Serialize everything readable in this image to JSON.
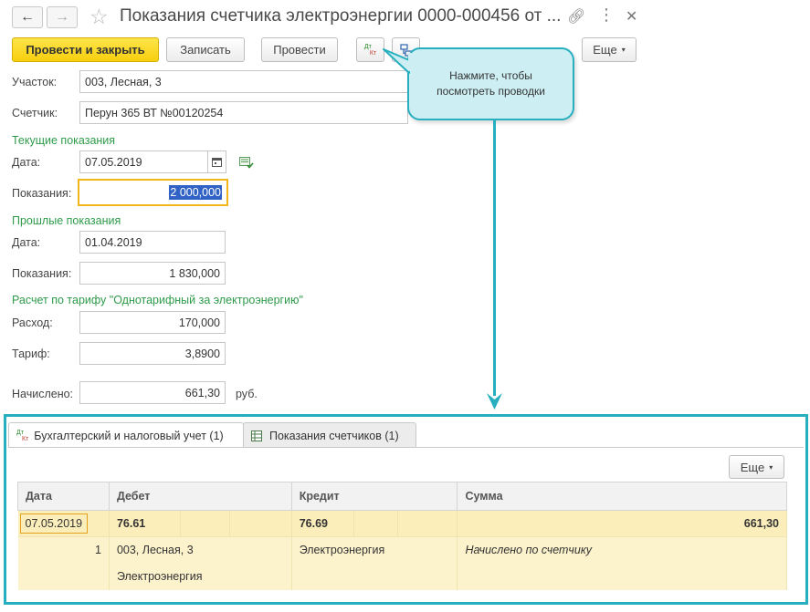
{
  "window": {
    "title": "Показания счетчика электроэнергии 0000-000456 от ..."
  },
  "toolbar": {
    "post_close": "Провести и закрыть",
    "save": "Записать",
    "post": "Провести",
    "dt": "Дт",
    "kt": "Кт",
    "more": "Еще"
  },
  "callout": {
    "text": "Нажмите, чтобы посмотреть проводки"
  },
  "form": {
    "site_label": "Участок:",
    "site_value": "003, Лесная, 3",
    "meter_label": "Счетчик:",
    "meter_value": "Перун 365 ВТ №00120254",
    "current_section": "Текущие показания",
    "current_date_label": "Дата:",
    "current_date": "07.05.2019",
    "current_reading_label": "Показания:",
    "current_reading": "2 000,000",
    "prev_section": "Прошлые показания",
    "prev_date_label": "Дата:",
    "prev_date": "01.04.2019",
    "prev_reading_label": "Показания:",
    "prev_reading": "1 830,000",
    "tariff_section": "Расчет по тарифу \"Однотарифный за электроэнергию\"",
    "usage_label": "Расход:",
    "usage_value": "170,000",
    "tariff_label": "Тариф:",
    "tariff_value": "3,8900",
    "charged_label": "Начислено:",
    "charged_value": "661,30",
    "currency": "руб."
  },
  "bottom": {
    "tabs": [
      {
        "label": "Бухгалтерский и налоговый учет (1)",
        "active": true
      },
      {
        "label": "Показания счетчиков (1)",
        "active": false
      }
    ],
    "more": "Еще",
    "columns": [
      "Дата",
      "Дебет",
      "Кредит",
      "Сумма"
    ],
    "row": {
      "date": "07.05.2019",
      "debit": "76.61",
      "credit": "76.69",
      "sum": "661,30",
      "number": "1",
      "debit_sub1": "003, Лесная, 3",
      "debit_sub2": "Электроэнергия",
      "credit_sub1": "Электроэнергия",
      "content": "Начислено по счетчику"
    }
  },
  "colors": {
    "accent": "#27aebf",
    "primary_button": "#f7cf0e",
    "section_text": "#2e9b4a",
    "row_highlight": "#fcf2cc"
  }
}
